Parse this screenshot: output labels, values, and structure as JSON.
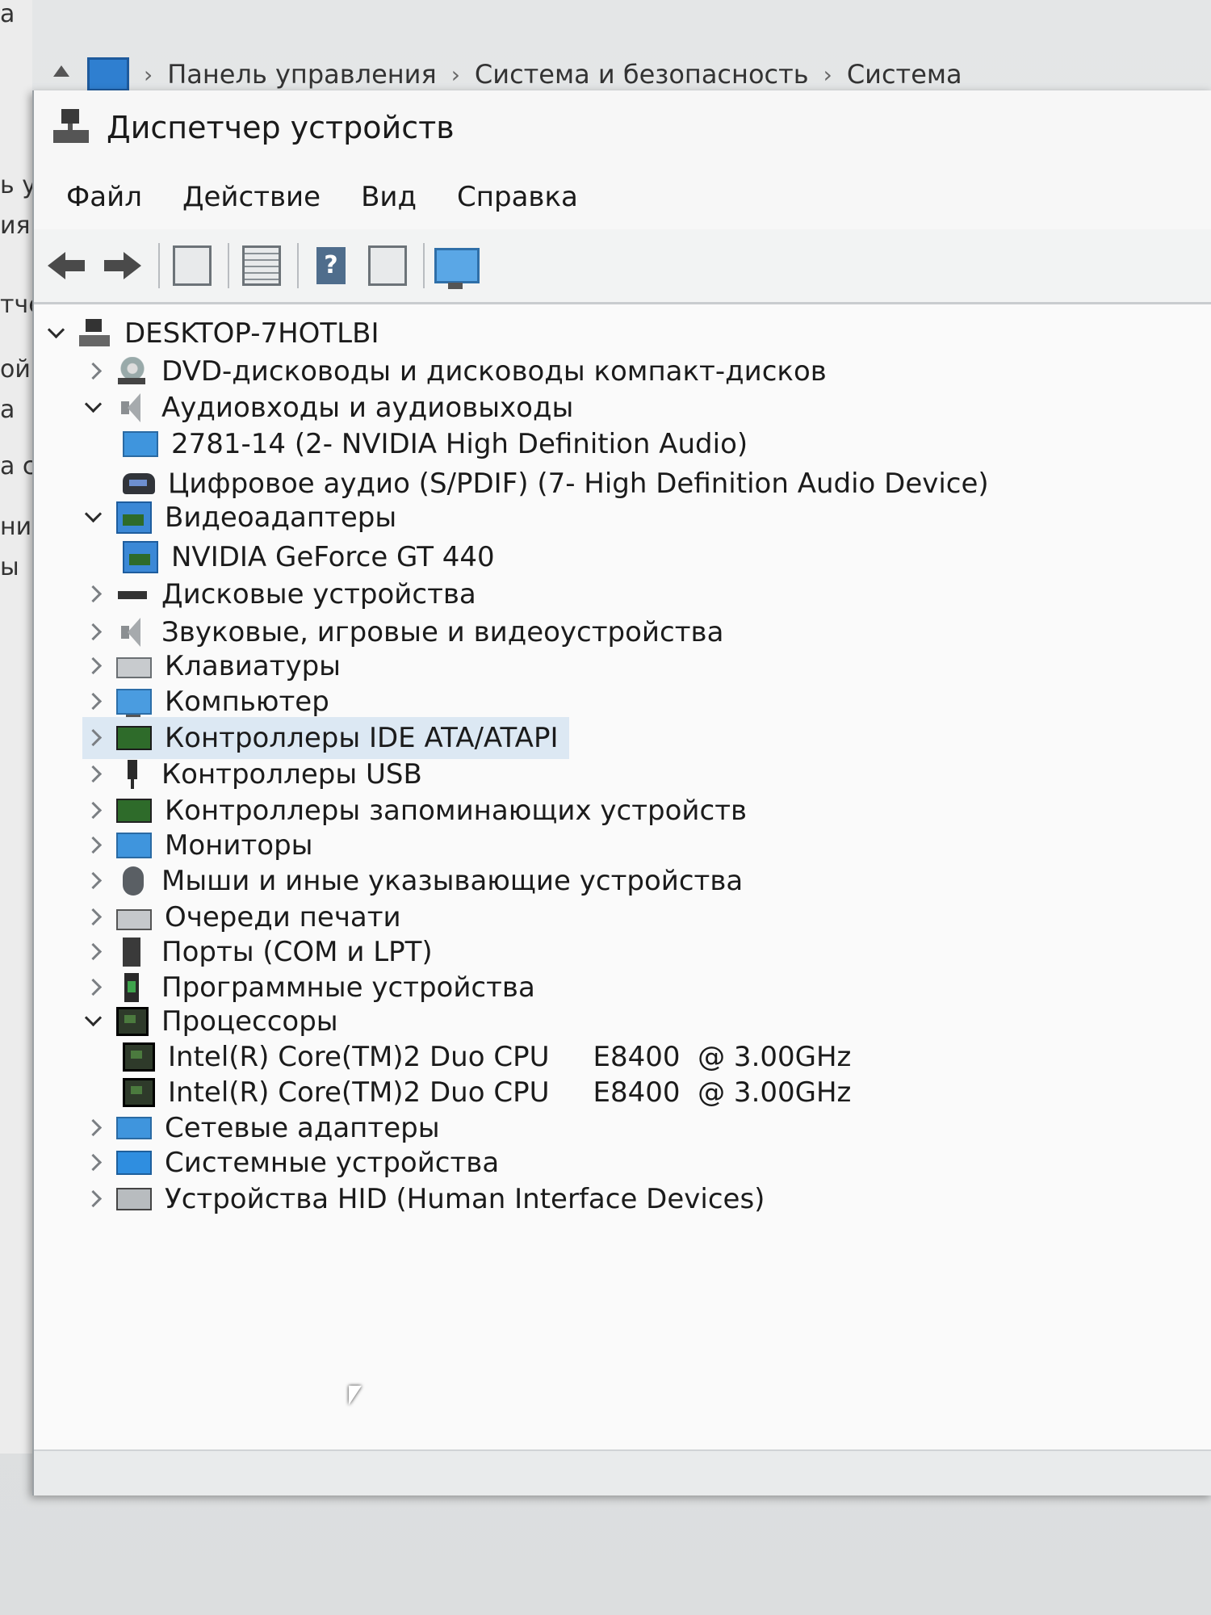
{
  "background": {
    "breadcrumb": [
      "Панель управления",
      "Система и безопасность",
      "Система"
    ],
    "left_fragments": [
      "a",
      "ь у",
      "ия",
      "тче",
      "ой",
      "а",
      "а с",
      "ни",
      "ы"
    ]
  },
  "window": {
    "title": "Диспетчер устройств",
    "menu": [
      "Файл",
      "Действие",
      "Вид",
      "Справка"
    ],
    "toolbar_icons": [
      "back-icon",
      "forward-icon",
      "show-hide-tree-icon",
      "properties-icon",
      "help-icon",
      "run-icon",
      "scan-hardware-icon"
    ]
  },
  "tree": {
    "root": "DESKTOP-7HOTLBI",
    "items": [
      {
        "label": "DVD-дисководы и дисководы компакт-дисков",
        "state": "collapsed",
        "icon": "dvd-icon"
      },
      {
        "label": "Аудиовходы и аудиовыходы",
        "state": "expanded",
        "icon": "speaker-icon"
      },
      {
        "label": "2781-14 (2- NVIDIA High Definition Audio)",
        "state": "leaf",
        "icon": "monitor-icon"
      },
      {
        "label": "Цифровое аудио (S/PDIF) (7- High Definition Audio Device)",
        "state": "leaf",
        "icon": "spdif-icon"
      },
      {
        "label": "Видеоадаптеры",
        "state": "expanded",
        "icon": "display-adapter-icon"
      },
      {
        "label": "NVIDIA GeForce GT 440",
        "state": "leaf",
        "icon": "display-adapter-icon"
      },
      {
        "label": "Дисковые устройства",
        "state": "collapsed",
        "icon": "disk-drive-icon"
      },
      {
        "label": "Звуковые, игровые и видеоустройства",
        "state": "collapsed",
        "icon": "speaker-icon"
      },
      {
        "label": "Клавиатуры",
        "state": "collapsed",
        "icon": "keyboard-icon"
      },
      {
        "label": "Компьютер",
        "state": "collapsed",
        "icon": "computer-icon"
      },
      {
        "label": "Контроллеры IDE ATA/ATAPI",
        "state": "collapsed",
        "icon": "ide-controller-icon"
      },
      {
        "label": "Контроллеры USB",
        "state": "collapsed",
        "icon": "usb-icon"
      },
      {
        "label": "Контроллеры запоминающих устройств",
        "state": "collapsed",
        "icon": "storage-controller-icon"
      },
      {
        "label": "Мониторы",
        "state": "collapsed",
        "icon": "monitor-icon"
      },
      {
        "label": "Мыши и иные указывающие устройства",
        "state": "collapsed",
        "icon": "mouse-icon"
      },
      {
        "label": "Очереди печати",
        "state": "collapsed",
        "icon": "printer-icon"
      },
      {
        "label": "Порты (COM и LPT)",
        "state": "collapsed",
        "icon": "port-icon"
      },
      {
        "label": "Программные устройства",
        "state": "collapsed",
        "icon": "software-device-icon"
      },
      {
        "label": "Процессоры",
        "state": "expanded",
        "icon": "cpu-icon"
      },
      {
        "label": "Intel(R) Core(TM)2 Duo CPU     E8400  @ 3.00GHz",
        "state": "leaf",
        "icon": "cpu-icon"
      },
      {
        "label": "Intel(R) Core(TM)2 Duo CPU     E8400  @ 3.00GHz",
        "state": "leaf",
        "icon": "cpu-icon"
      },
      {
        "label": "Сетевые адаптеры",
        "state": "collapsed",
        "icon": "network-adapter-icon"
      },
      {
        "label": "Системные устройства",
        "state": "collapsed",
        "icon": "system-device-icon"
      },
      {
        "label": "Устройства HID (Human Interface Devices)",
        "state": "collapsed",
        "icon": "hid-icon"
      }
    ],
    "selected_label": "Контроллеры IDE ATA/ATAPI"
  }
}
